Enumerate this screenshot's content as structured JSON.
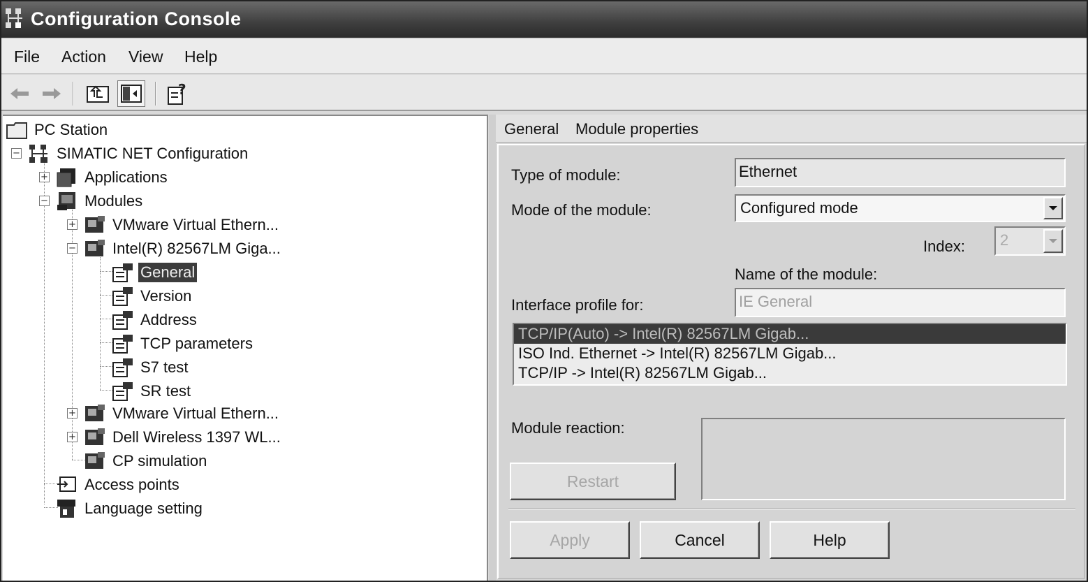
{
  "window": {
    "title": "Configuration Console"
  },
  "menu": [
    "File",
    "Action",
    "View",
    "Help"
  ],
  "toolbar": {
    "buttons": [
      "back-arrow-icon",
      "forward-arrow-icon",
      "up-folder-icon",
      "show-hide-tree-icon",
      "properties-help-icon"
    ]
  },
  "tree": {
    "root": "PC Station",
    "simatic": "SIMATIC NET Configuration",
    "applications": "Applications",
    "modules": "Modules",
    "module_items": [
      "VMware Virtual Ethern...",
      "Intel(R) 82567LM Giga...",
      "VMware Virtual Ethern...",
      "Dell Wireless 1397 WL...",
      "CP simulation"
    ],
    "intel_children": [
      "General",
      "Version",
      "Address",
      "TCP parameters",
      "S7 test",
      "SR test"
    ],
    "access_points": "Access points",
    "language_setting": "Language setting",
    "selected": "General"
  },
  "tabs": [
    "General",
    "Module properties"
  ],
  "form": {
    "type_label": "Type of module:",
    "type_value": "Ethernet",
    "mode_label": "Mode of the module:",
    "mode_value": "Configured mode",
    "index_label": "Index:",
    "index_value": "2",
    "name_label": "Name of the module:",
    "interface_label": "Interface profile for:",
    "interface_value": "IE General",
    "profiles": [
      "TCP/IP(Auto) -> Intel(R) 82567LM Gigab...",
      "ISO Ind. Ethernet -> Intel(R) 82567LM Gigab...",
      "TCP/IP -> Intel(R) 82567LM Gigab..."
    ],
    "selected_profile": 0,
    "reaction_label": "Module reaction:",
    "restart_label": "Restart"
  },
  "buttons": {
    "apply": "Apply",
    "cancel": "Cancel",
    "help": "Help"
  }
}
